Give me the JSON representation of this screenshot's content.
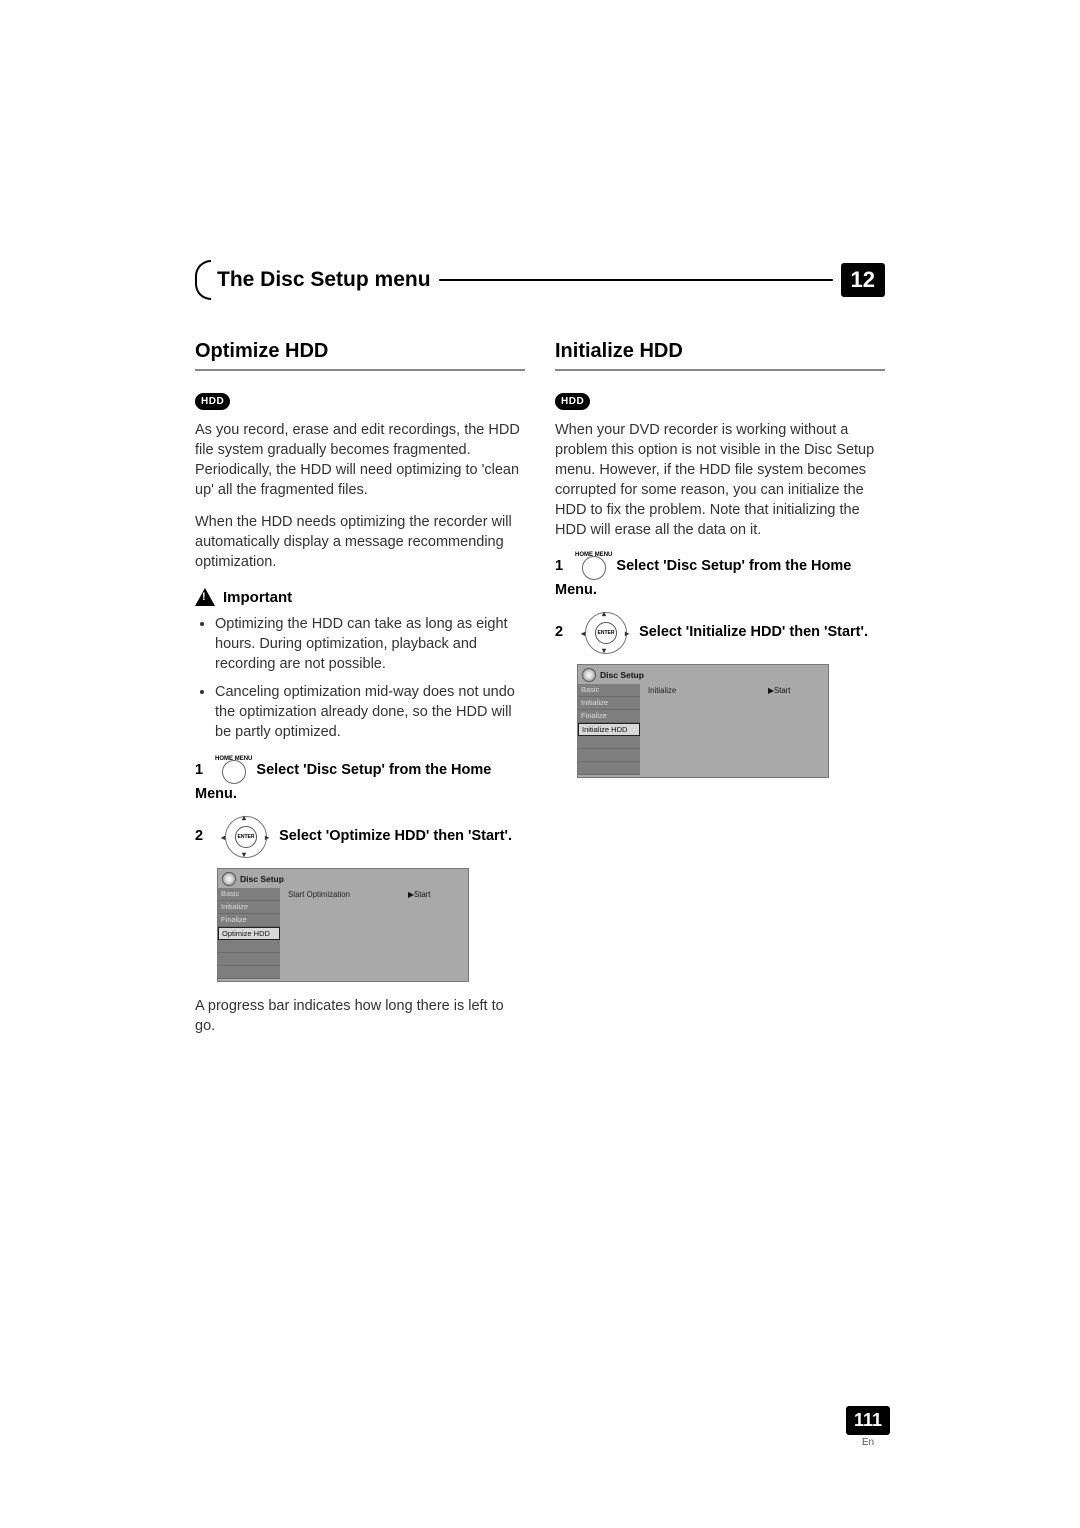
{
  "header": {
    "title": "The Disc Setup menu",
    "chapter": "12"
  },
  "page": {
    "number": "111",
    "lang": "En"
  },
  "badges": {
    "hdd": "HDD"
  },
  "left": {
    "heading": "Optimize HDD",
    "para1": "As you record, erase and edit recordings, the HDD file system gradually becomes fragmented. Periodically, the HDD will need optimizing to 'clean up' all the fragmented files.",
    "para2": "When the HDD needs optimizing the recorder will automatically display a message recommending optimization.",
    "important_label": "Important",
    "bullets": [
      "Optimizing the HDD can take as long as eight hours. During optimization, playback and recording are not possible.",
      "Canceling optimization mid-way does not undo the optimization already done, so the HDD will be partly optimized."
    ],
    "step1": {
      "num": "1",
      "btn_top": "HOME MENU",
      "text": "Select 'Disc Setup' from the Home Menu."
    },
    "step2": {
      "num": "2",
      "enter": "ENTER",
      "text": "Select 'Optimize HDD' then 'Start'."
    },
    "screenshot": {
      "title": "Disc Setup",
      "left_items": [
        "Basic",
        "Initialize",
        "Finalize",
        "Optimize HDD"
      ],
      "selected_index": 3,
      "mid": "Start Optimization",
      "right": "Start"
    },
    "footer": "A progress bar indicates how long there is left to go."
  },
  "right": {
    "heading": "Initialize HDD",
    "para1": "When your DVD recorder is working without a problem this option is not visible in the Disc Setup menu. However, if the HDD file system becomes corrupted for some reason, you can initialize the HDD to fix the problem. Note that initializing the HDD will erase all the data on it.",
    "step1": {
      "num": "1",
      "btn_top": "HOME MENU",
      "text": "Select 'Disc Setup' from the Home Menu."
    },
    "step2": {
      "num": "2",
      "enter": "ENTER",
      "text": "Select 'Initialize HDD' then 'Start'."
    },
    "screenshot": {
      "title": "Disc Setup",
      "left_items": [
        "Basic",
        "Initialize",
        "Finalize",
        "Initialize HDD"
      ],
      "selected_index": 3,
      "mid": "Initialize",
      "right": "Start"
    }
  }
}
